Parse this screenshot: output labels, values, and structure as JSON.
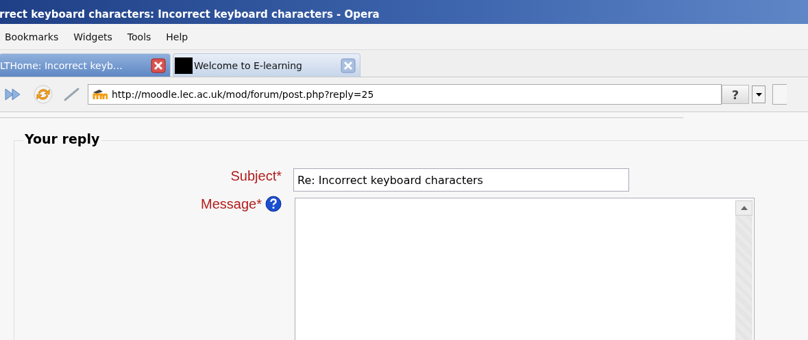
{
  "window": {
    "title": "rrect keyboard characters: Incorrect keyboard characters - Opera"
  },
  "menu": [
    "Bookmarks",
    "Widgets",
    "Tools",
    "Help"
  ],
  "tabs": [
    {
      "label": "LTHome: Incorrect keyb…",
      "selected": true
    },
    {
      "label": "Welcome to E-learning",
      "selected": false
    }
  ],
  "address_bar": {
    "url": "http://moodle.lec.ac.uk/mod/forum/post.php?reply=25",
    "help_button": "?"
  },
  "form": {
    "legend": "Your reply",
    "fields": [
      {
        "kind": "text",
        "label": "Subject",
        "required_mark": "*",
        "value": "Re: Incorrect keyboard characters",
        "help": false
      },
      {
        "kind": "textarea",
        "label": "Message",
        "required_mark": "*",
        "help": true
      }
    ]
  }
}
